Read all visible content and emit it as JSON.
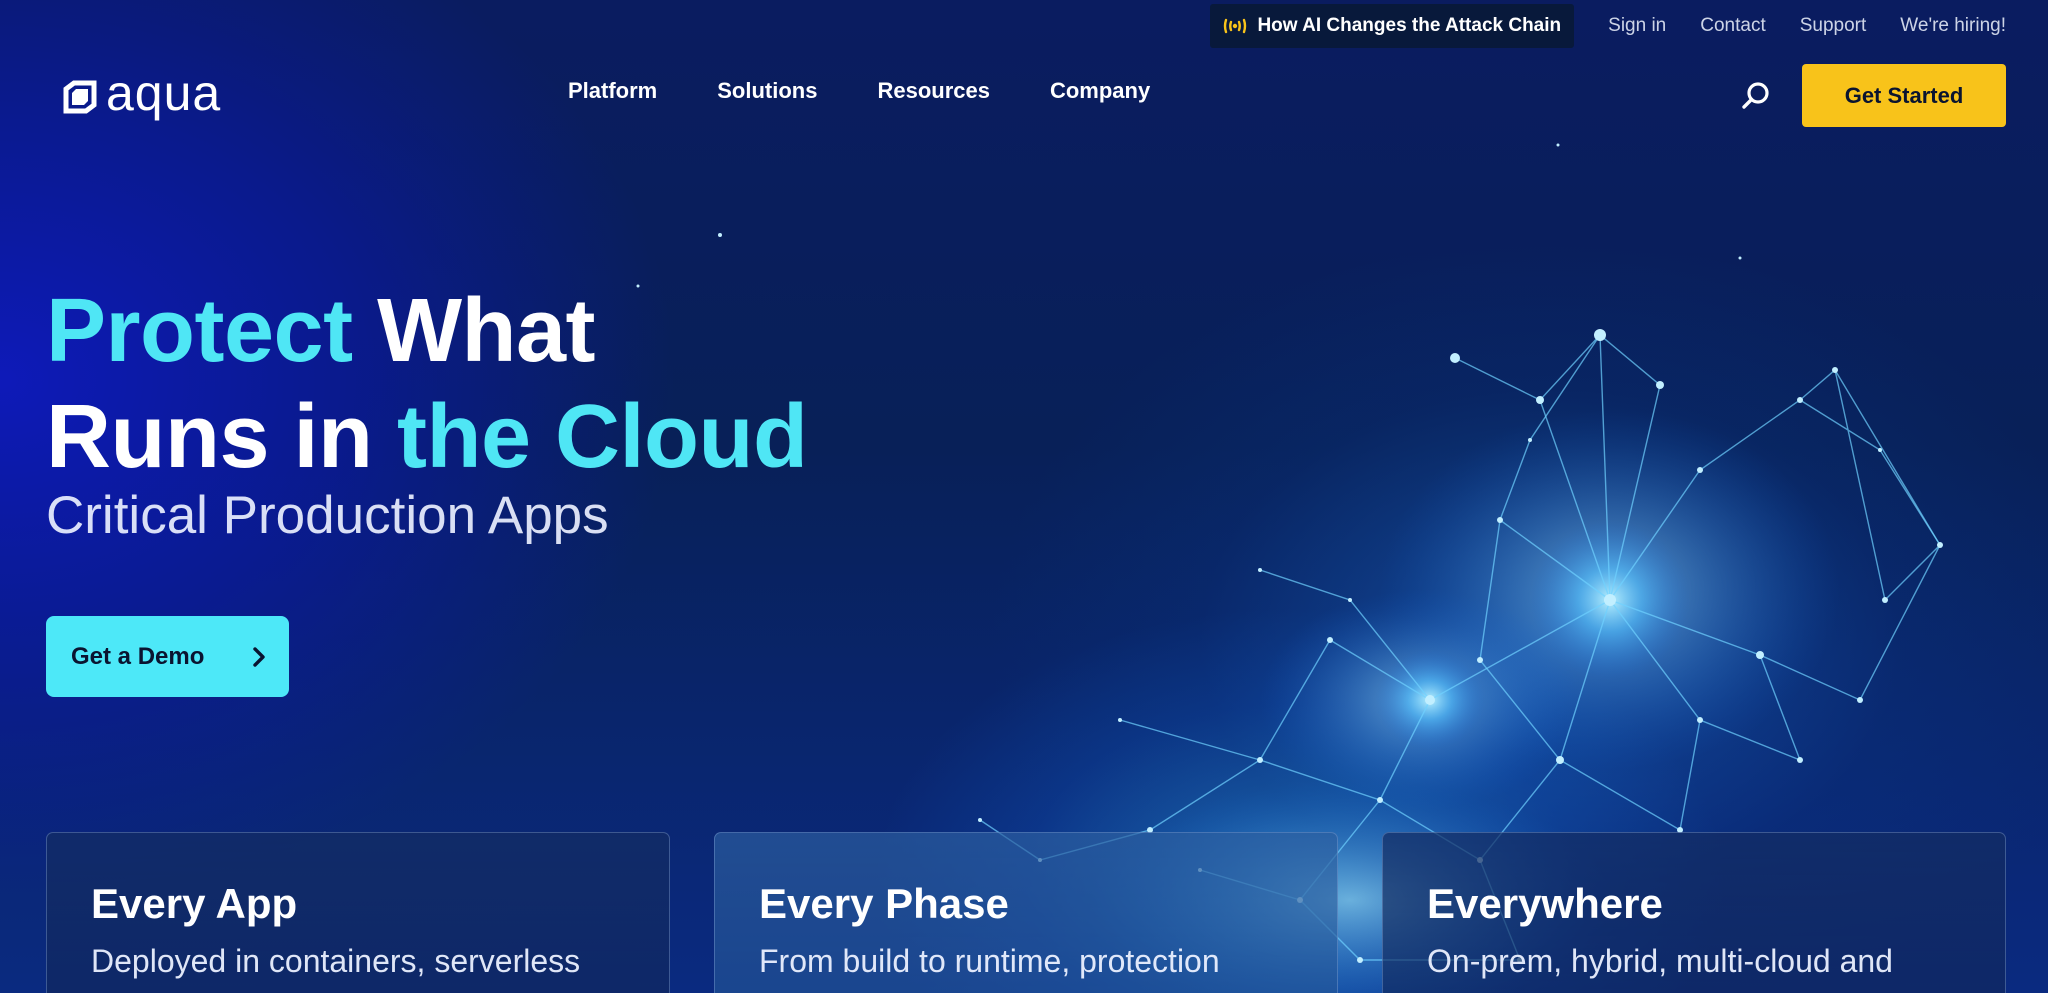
{
  "utility_bar": {
    "promo": "How AI Changes the Attack Chain",
    "links": [
      "Sign in",
      "Contact",
      "Support",
      "We're hiring!"
    ]
  },
  "brand": {
    "logo_text": "aqua"
  },
  "nav": {
    "items": [
      "Platform",
      "Solutions",
      "Resources",
      "Company"
    ],
    "cta": "Get Started"
  },
  "hero": {
    "title_part1": "Protect",
    "title_part2": " What",
    "title_part3": "Runs in ",
    "title_part4": "the Cloud",
    "subtitle": "Critical Production Apps",
    "button": "Get a Demo"
  },
  "cards": [
    {
      "title": "Every App",
      "text": "Deployed in containers, serverless"
    },
    {
      "title": "Every Phase",
      "text": "From build to runtime, protection"
    },
    {
      "title": "Everywhere",
      "text": "On-prem, hybrid, multi-cloud and"
    }
  ],
  "colors": {
    "accent": "#4fe6f5",
    "cta_yellow": "#f8c31a",
    "background": "#0a1c60"
  },
  "icons": {
    "promo": "signal-wave-icon",
    "search": "search-icon",
    "demo": "chevron-right-icon"
  }
}
